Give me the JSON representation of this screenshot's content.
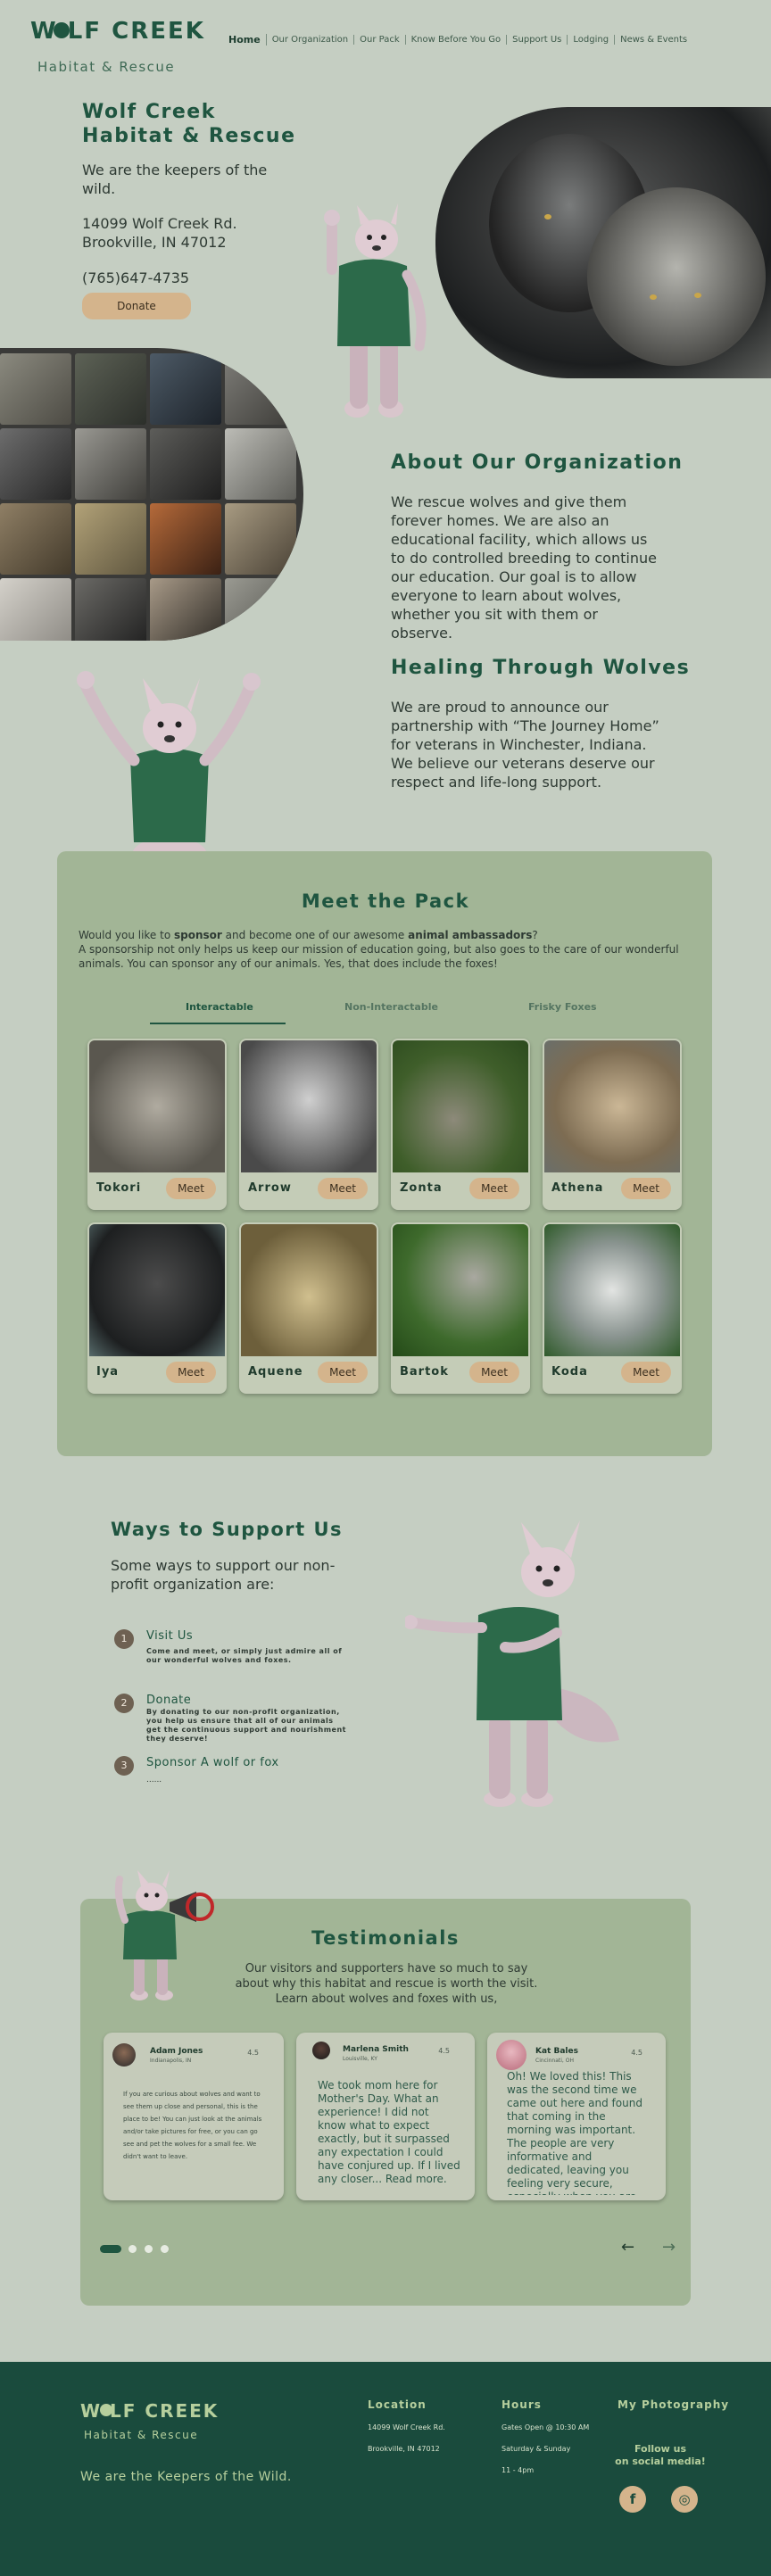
{
  "header": {
    "logo_text": "W  LF CREEK",
    "logo_sub": "Habitat & Rescue",
    "nav": [
      "Home",
      "Our Organization",
      "Our Pack",
      "Know Before You Go",
      "Support Us",
      "Lodging",
      "News & Events"
    ]
  },
  "hero": {
    "title_line1": "Wolf Creek",
    "title_line2": "Habitat & Rescue",
    "tagline": "We are the keepers of the wild.",
    "address_line1": "14099 Wolf Creek Rd.",
    "address_line2": "Brookville, IN 47012",
    "phone": "(765)647-4735",
    "donate_label": "Donate"
  },
  "about": {
    "heading": "About Our Organization",
    "body": "We rescue wolves and give them forever homes. We are also an educational facility, which allows us to do controlled breeding to continue our education. Our goal is to allow everyone to learn about wolves, whether you sit with them or observe.",
    "heading2": "Healing Through Wolves",
    "body2": "We are proud to announce our partnership with “The Journey Home” for veterans in Winchester, Indiana.  We believe our veterans deserve our respect and life-long support."
  },
  "pack": {
    "heading": "Meet the Pack",
    "intro_pre": "Would you like to ",
    "intro_bold1": "sponsor",
    "intro_mid": " and become one of our awesome ",
    "intro_bold2": "animal ambassadors",
    "intro_post": "?",
    "intro_line2": "A sponsorship not only helps us keep our mission of education going, but also goes to the care of our wonderful animals. You can sponsor any of our animals. Yes, that does include the foxes!",
    "tabs": [
      "Interactable",
      "Non-Interactable",
      "Frisky Foxes"
    ],
    "meet_label": "Meet",
    "animals": [
      "Tokori",
      "Arrow",
      "Zonta",
      "Athena",
      "Iya",
      "Aquene",
      "Bartok",
      "Koda"
    ]
  },
  "support": {
    "heading": "Ways to Support Us",
    "subheading": "Some ways to support our non-profit organization are:",
    "items": [
      {
        "num": "1",
        "title": "Visit Us",
        "desc": "Come and meet, or simply just admire all of our wonderful wolves and foxes."
      },
      {
        "num": "2",
        "title": "Donate",
        "desc": "By donating to our non-profit organization, you help us ensure that all of our animals get the continuous support and nourishment they deserve!"
      },
      {
        "num": "3",
        "title": "Sponsor A wolf or fox",
        "desc": "......"
      }
    ]
  },
  "testimonials": {
    "heading": "Testimonials",
    "intro": "Our visitors and supporters have so much to say about why this habitat and rescue is worth the visit.  Learn about wolves and foxes with us,",
    "cards": [
      {
        "name": "Adam Jones",
        "loc": "Indianapolis, IN",
        "rating": "4.5",
        "text": "If you are curious about wolves and want to see them up close and personal, this is the place to be! You can just look at the animals and/or take pictures for free, or you can go see and pet the wolves for a small fee. We didn't want to leave."
      },
      {
        "name": "Marlena Smith",
        "loc": "Louisville, KY",
        "rating": "4.5",
        "text": "We took mom here for Mother's Day. What an experience! I did not know what to expect exactly, but it surpassed any expectation I could have conjured up. If I lived any closer... Read more."
      },
      {
        "name": "Kat Bales",
        "loc": "Cincinnati, OH",
        "rating": "4.5",
        "text": "Oh! We loved this! This was the second time we came out here and found that coming in the morning was important. The people are very informative and dedicated, leaving you feeling very secure, especially when you are inside the cages with the wolves."
      }
    ],
    "prev": "←",
    "next": "→"
  },
  "footer": {
    "logo_text": "W  LF CREEK",
    "logo_sub": "Habitat & Rescue",
    "tagline": "We are the Keepers of the Wild.",
    "location_h": "Location",
    "location_1": "14099 Wolf Creek Rd.",
    "location_2": "Brookville, IN 47012",
    "hours_h": "Hours",
    "hours_1": "Gates Open @ 10:30 AM",
    "hours_2": "Saturday & Sunday",
    "hours_3": "11 - 4pm",
    "photo_h": "My Photography",
    "follow_1": "Follow us",
    "follow_2": "on social media!",
    "facebook": "f",
    "instagram": "◎"
  },
  "colors": {
    "background": "#c5cec2",
    "brand_green": "#1f5540",
    "panel_green": "#a2b596",
    "button_tan": "#d4b48c",
    "footer": "#1a4b3d"
  }
}
